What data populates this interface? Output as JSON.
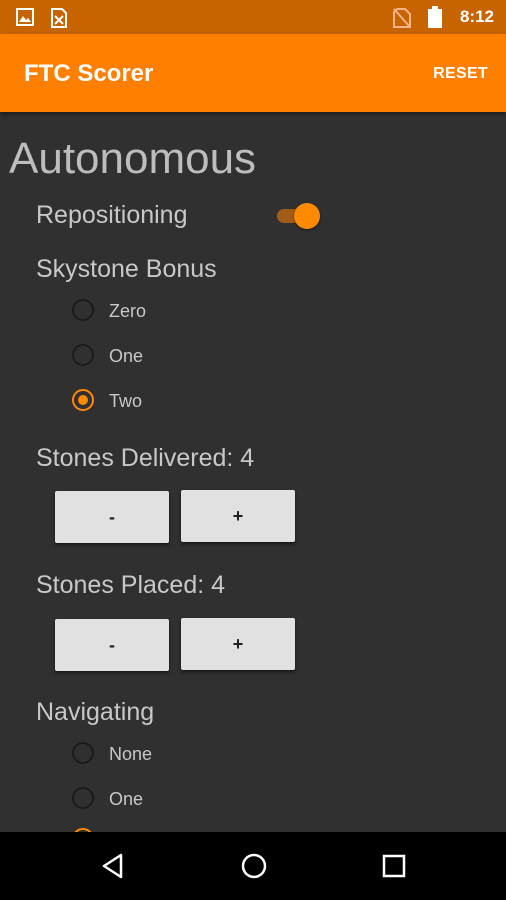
{
  "status_bar": {
    "time": "8:12",
    "icons": [
      "image-icon",
      "file-x-icon",
      "no-sim-icon",
      "battery-icon"
    ],
    "color": "#c76400"
  },
  "app_bar": {
    "title": "FTC Scorer",
    "reset_label": "RESET",
    "color": "#ff7f00"
  },
  "autonomous": {
    "section_title": "Autonomous",
    "repositioning": {
      "label": "Repositioning",
      "on": true
    },
    "skystone_bonus": {
      "label": "Skystone Bonus",
      "options": [
        "Zero",
        "One",
        "Two"
      ],
      "selected": "Two"
    },
    "stones_delivered": {
      "label": "Stones Delivered: 4",
      "minus_label": "-",
      "plus_label": "+"
    },
    "stones_placed": {
      "label": "Stones Placed: 4",
      "minus_label": "-",
      "plus_label": "+"
    },
    "navigating": {
      "label": "Navigating",
      "options": [
        "None",
        "One"
      ],
      "selected": null
    }
  },
  "accent_color": "#ff8a00",
  "nav_bar": {
    "icons": [
      "back-triangle-icon",
      "home-circle-icon",
      "recents-square-icon"
    ]
  }
}
